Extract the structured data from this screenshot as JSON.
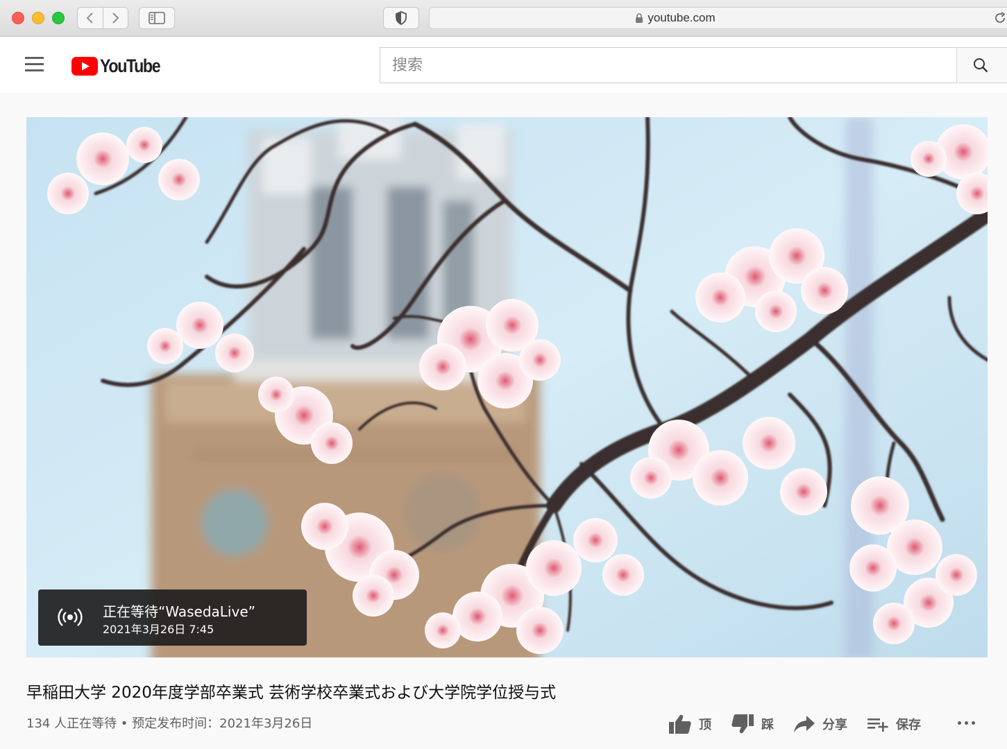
{
  "browser": {
    "address": "youtube.com"
  },
  "header": {
    "logo_text": "YouTube",
    "search_placeholder": "搜索"
  },
  "player": {
    "waiting_title": "正在等待“WasedaLive”",
    "waiting_date": "2021年3月26日 7:45"
  },
  "video": {
    "title": "早稲田大学 2020年度学部卒業式 芸術学校卒業式および大学院学位授与式",
    "meta": "134 人正在等待 • 预定发布时间：2021年3月26日"
  },
  "actions": {
    "like_label": "顶",
    "dislike_label": "踩",
    "share_label": "分享",
    "save_label": "保存"
  },
  "colors": {
    "brand_red": "#ff0000",
    "text_secondary": "#606060"
  }
}
